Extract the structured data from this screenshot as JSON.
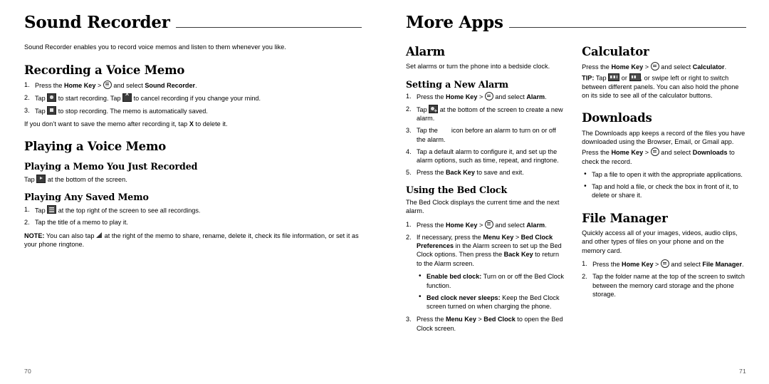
{
  "left_page": {
    "chapter_title": "Sound Recorder",
    "intro": "Sound Recorder enables you to record voice memos and listen to them whenever you like.",
    "section_recording": {
      "heading": "Recording a Voice Memo",
      "step1_a": "Press the ",
      "step1_home": "Home Key",
      "step1_b": " > ",
      "step1_c": " and select ",
      "step1_app": "Sound Recorder",
      "step1_d": ".",
      "step2_a": "Tap ",
      "step2_b": " to start recording. Tap ",
      "step2_c": " to cancel recording if you change your mind.",
      "step3_a": "Tap ",
      "step3_b": " to stop recording. The memo is automatically saved.",
      "note_a": "If you don’t want to save the memo after recording it, tap ",
      "note_x": "X",
      "note_b": " to delete it."
    },
    "section_playing": {
      "heading": "Playing a Voice Memo",
      "sub_just_recorded": "Playing a Memo You Just Recorded",
      "just_recorded_a": "Tap ",
      "just_recorded_b": " at the bottom of the screen.",
      "sub_any_saved": "Playing Any Saved Memo",
      "saved_step1_a": "Tap ",
      "saved_step1_b": " at the top right of the screen to see all recordings.",
      "saved_step2": "Tap the title of a memo to play it.",
      "note_label": "NOTE:",
      "note_a": " You can also tap ",
      "note_b": " at the right of the memo to share, rename, delete it, check its file information, or set it as your phone ringtone."
    },
    "folio": "70"
  },
  "right_page": {
    "chapter_title": "More Apps",
    "column_a": {
      "alarm": {
        "heading": "Alarm",
        "intro": "Set alarms or turn the phone into a bedside clock.",
        "sub_new_alarm": "Setting a New Alarm",
        "step1_a": "Press the ",
        "step1_home": "Home Key",
        "step1_b": " > ",
        "step1_c": " and select ",
        "step1_app": "Alarm",
        "step1_d": ".",
        "step2_a": "Tap ",
        "step2_b": " at the bottom of the screen to create a new alarm.",
        "step3_a": "Tap the ",
        "step3_b": " icon before an alarm to turn on or off the alarm.",
        "step4": "Tap a default alarm to configure it, and set up the alarm options, such as time, repeat, and ringtone.",
        "step5_a": "Press the ",
        "step5_key": "Back Key",
        "step5_b": " to save and exit."
      },
      "bed_clock": {
        "sub_heading": "Using the Bed Clock",
        "intro": "The Bed Clock displays the current time and the next alarm.",
        "step1_a": "Press the ",
        "step1_home": "Home Key",
        "step1_b": " > ",
        "step1_c": " and select ",
        "step1_app": "Alarm",
        "step1_d": ".",
        "step2_a": "If necessary, press the ",
        "step2_menu": "Menu Key",
        "step2_b": " > ",
        "step2_pref": "Bed Clock Preferences",
        "step2_c": " in the Alarm screen to set up the Bed Clock options. Then press the ",
        "step2_back": "Back Key",
        "step2_d": " to return to the Alarm screen.",
        "bullet1_label": "Enable bed clock:",
        "bullet1_text": " Turn on or off the Bed Clock function.",
        "bullet2_label": "Bed clock never sleeps:",
        "bullet2_text": " Keep the Bed Clock screen turned on when charging the phone.",
        "step3_a": "Press the ",
        "step3_menu": "Menu Key",
        "step3_b": " > ",
        "step3_bed": "Bed Clock",
        "step3_c": " to open the Bed Clock screen."
      }
    },
    "column_b": {
      "calculator": {
        "heading": "Calculator",
        "line1_a": "Press the ",
        "line1_home": "Home Key",
        "line1_b": " > ",
        "line1_c": " and select ",
        "line1_app": "Calculator",
        "line1_d": ".",
        "tip_label": "TIP:",
        "tip_a": " Tap ",
        "tip_or": " or ",
        "tip_b": ", or swipe left or right to switch between different panels. You can also hold the phone on its side to see all of the calculator buttons."
      },
      "downloads": {
        "heading": "Downloads",
        "intro": "The Downloads app keeps a record of the files you have downloaded using the Browser, Email, or Gmail app.",
        "line2_a": "Press the ",
        "line2_home": "Home Key",
        "line2_b": " > ",
        "line2_c": " and select ",
        "line2_app": "Downloads",
        "line2_d": " to check the record.",
        "bullet1": "Tap a file to open it with the appropriate applications.",
        "bullet2": "Tap and hold a file, or check the box in front of it, to delete or share it."
      },
      "file_manager": {
        "heading": "File Manager",
        "intro": "Quickly access all of your images, videos, audio clips, and other types of files on your phone and on the memory card.",
        "step1_a": "Press the ",
        "step1_home": "Home Key",
        "step1_b": " > ",
        "step1_c": " and select ",
        "step1_app": "File Manager",
        "step1_d": ".",
        "step2": "Tap the folder name at the top of the screen to switch between the memory card storage and the phone storage."
      }
    },
    "folio": "71"
  }
}
